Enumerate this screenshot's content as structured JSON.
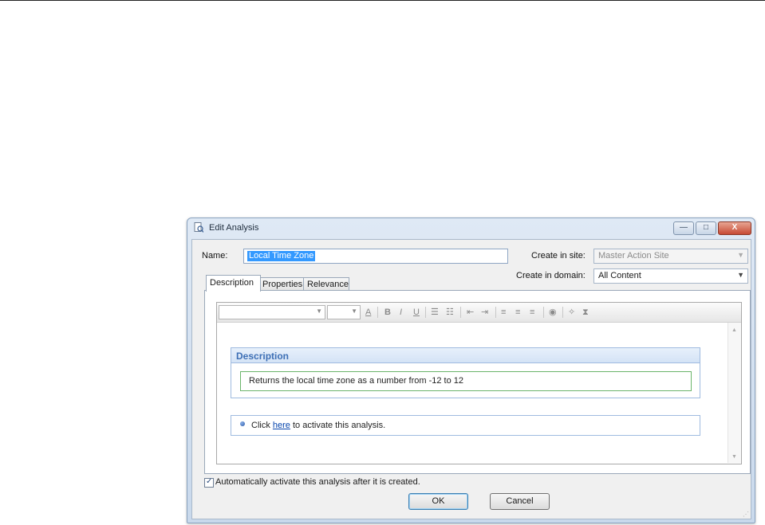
{
  "window": {
    "title": "Edit Analysis",
    "buttons": {
      "minimize": "—",
      "maximize": "□",
      "close": "X"
    }
  },
  "form": {
    "name_label": "Name:",
    "name_value": "Local Time Zone",
    "site_label": "Create in site:",
    "site_value": "Master Action Site",
    "domain_label": "Create in domain:",
    "domain_value": "All Content"
  },
  "tabs": [
    "Description",
    "Properties",
    "Relevance"
  ],
  "active_tab": "Description",
  "editor": {
    "toolbar_icons": [
      "font-name-select",
      "font-size-select",
      "text-color-icon",
      "bold-icon",
      "italic-icon",
      "underline-icon",
      "numbered-list-icon",
      "bullet-list-icon",
      "outdent-icon",
      "indent-icon",
      "align-left-icon",
      "align-center-icon",
      "align-right-icon",
      "link-icon",
      "clean-icon",
      "source-icon"
    ],
    "toolbar_glyphs": {
      "text_color": "A",
      "bold": "B",
      "italic": "I",
      "underline": "U"
    },
    "description_heading": "Description",
    "description_text": "Returns the local time zone as a number from -12 to 12",
    "activate_prefix": "Click ",
    "activate_link": "here",
    "activate_suffix": " to activate this analysis."
  },
  "auto_activate": {
    "checked": true,
    "label": "Automatically activate this analysis after it is created."
  },
  "footer": {
    "ok_label": "OK",
    "cancel_label": "Cancel"
  }
}
